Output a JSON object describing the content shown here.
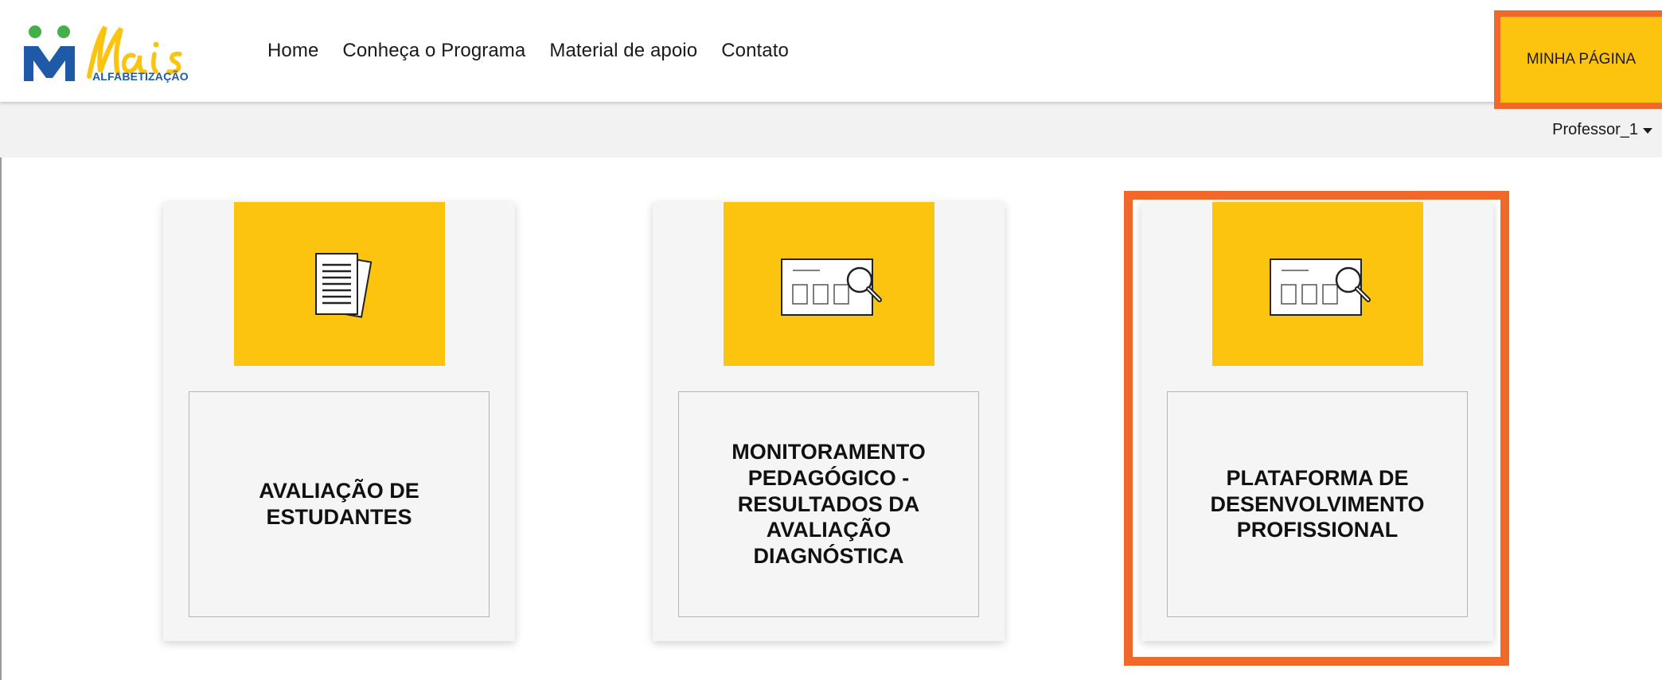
{
  "header": {
    "logo": {
      "brand": "Mais",
      "tagline": "ALFABETIZAÇÃO"
    },
    "nav": [
      {
        "label": "Home"
      },
      {
        "label": "Conheça o Programa"
      },
      {
        "label": "Material de apoio"
      },
      {
        "label": "Contato"
      }
    ],
    "my_page_button": "MINHA PÁGINA"
  },
  "subbar": {
    "user": "Professor_1"
  },
  "cards": [
    {
      "title": "AVALIAÇÃO DE ESTUDANTES",
      "icon": "documents-icon"
    },
    {
      "title": "MONITORAMENTO PEDAGÓGICO - RESULTADOS DA AVALIAÇÃO DIAGNÓSTICA",
      "icon": "dashboard-search-icon"
    },
    {
      "title": "PLATAFORMA DE DESENVOLVIMENTO PROFISSIONAL",
      "icon": "dashboard-search-icon"
    }
  ],
  "colors": {
    "accent_yellow": "#fdc40f",
    "highlight_orange": "#f0682a",
    "logo_blue": "#1e5aa8",
    "logo_green": "#43b049"
  }
}
